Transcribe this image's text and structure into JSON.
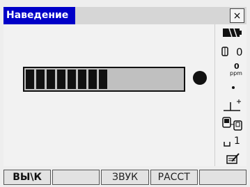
{
  "window": {
    "title": "Наведение",
    "close_label": "×"
  },
  "signal": {
    "level_fraction": 0.61,
    "segments_filled": 8
  },
  "status": {
    "battery_icon": "battery-full-icon",
    "prism_constant": "0",
    "ppm_value": "0",
    "ppm_unit": "ppm",
    "target_mode_label": "1"
  },
  "softkeys": [
    {
      "label": "ВЫ\\К"
    },
    {
      "label": ""
    },
    {
      "label": "ЗВУК"
    },
    {
      "label": "РАССТ"
    },
    {
      "label": ""
    }
  ],
  "colors": {
    "title_bg": "#0000c8",
    "title_text": "#ffffff",
    "bar_fill": "#111111",
    "bar_bg": "#c0c0c0"
  }
}
